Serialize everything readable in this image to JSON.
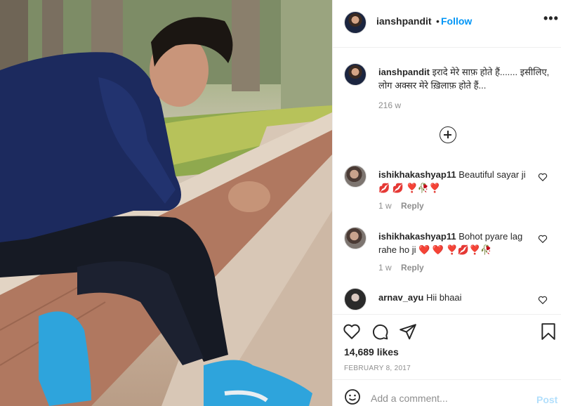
{
  "post": {
    "username": "ianshpandit",
    "follow_label": "Follow",
    "separator": "•",
    "more_label": "•••"
  },
  "caption": {
    "username": "ianshpandit",
    "text": "इरादे मेरे साफ़ होते हैं....... इसीलिए, लोग अक्सर मेरे ख़िलाफ़ होते हैं...",
    "time": "216 w"
  },
  "comments": [
    {
      "username": "ishikhakashyap11",
      "text": "Beautiful sayar ji 💋 💋 ❣️🥀❣️",
      "time": "1 w",
      "reply": "Reply"
    },
    {
      "username": "ishikhakashyap11",
      "text": "Bohot pyare lag rahe ho ji ❤️ ❤️ ❣️💋❣️🥀",
      "time": "1 w",
      "reply": "Reply"
    },
    {
      "username": "arnav_ayu",
      "text": "Hii bhaai"
    }
  ],
  "stats": {
    "likes": "14,689 likes",
    "date": "FEBRUARY 8, 2017"
  },
  "add_comment": {
    "placeholder": "Add a comment...",
    "post_label": "Post"
  },
  "icons": {
    "like": "heart-icon",
    "comment": "comment-bubble-icon",
    "share": "paper-plane-icon",
    "save": "bookmark-icon",
    "load_more": "plus-circle-icon",
    "emoji": "smiley-icon"
  },
  "colors": {
    "link": "#0095f6",
    "muted": "#8e8e8e",
    "post_disabled": "#b2dffc"
  }
}
